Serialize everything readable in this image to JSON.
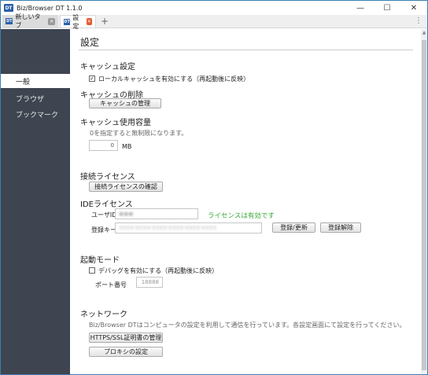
{
  "window": {
    "title": "Biz/Browser DT 1.1.0",
    "app_icon": "DT",
    "controls": {
      "minimize": "—",
      "maximize": "☐",
      "close": "✕"
    }
  },
  "tabs": [
    {
      "label": "新しいタブ",
      "logo": "DT",
      "close": "×",
      "active": false
    },
    {
      "label": "設定",
      "logo": "DT",
      "close": "×",
      "active": true
    }
  ],
  "tab_add": "+",
  "tab_menu": "⋮",
  "sidebar": {
    "items": [
      {
        "label": "一般",
        "selected": true
      },
      {
        "label": "ブラウザ",
        "selected": false
      },
      {
        "label": "ブックマーク",
        "selected": false
      }
    ]
  },
  "settings": {
    "page_title": "設定",
    "cache": {
      "heading": "キャッシュ設定",
      "local_cache_checkbox": "ローカルキャッシュを有効にする（再起動後に反映）",
      "local_cache_checked": true,
      "delete_heading": "キャッシュの削除",
      "manage_button": "キャッシュの管理",
      "size_heading": "キャッシュ使用容量",
      "size_note": "0を指定すると無制限になります。",
      "size_value": "0",
      "size_unit": "MB"
    },
    "license": {
      "heading": "接続ライセンス",
      "confirm_button": "接続ライセンスの確認"
    },
    "ide": {
      "heading": "IDEライセンス",
      "user_id_label": "ユーザID",
      "user_id_value": "●●●",
      "status": "ライセンスは有効です",
      "key_label": "登録キー",
      "key_value": "XXXX-XXXX-XXXX-XXXX-XXXX-XXXX",
      "register_button": "登録/更新",
      "unregister_button": "登録解除"
    },
    "startup": {
      "heading": "起動モード",
      "debug_checkbox": "デバッグを有効にする（再起動後に反映）",
      "debug_checked": false,
      "port_label": "ポート番号",
      "port_value": "18888"
    },
    "network": {
      "heading": "ネットワーク",
      "note": "Biz/Browser DTはコンピュータの設定を利用して通信を行っています。各設定画面にて設定を行ってください。",
      "cert_button": "HTTPS/SSL証明書の管理",
      "proxy_button": "プロキシの設定"
    }
  },
  "colors": {
    "sidebar_bg": "#3e4550",
    "accent": "#2b5fa8",
    "close_active": "#e4572e",
    "status_ok": "#3aa83a"
  }
}
